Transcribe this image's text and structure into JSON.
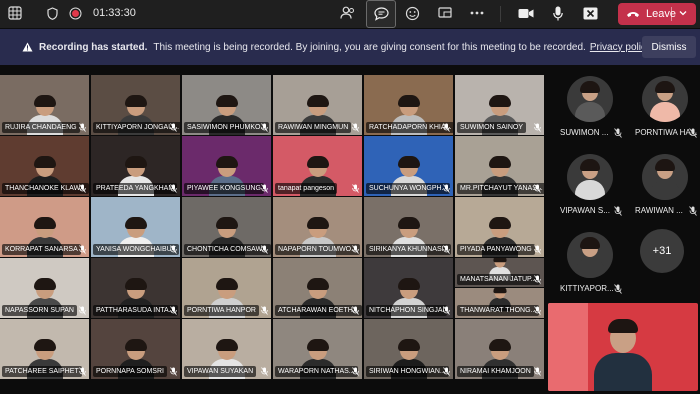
{
  "toolbar": {
    "timer": "01:33:30",
    "leave_label": "Leave"
  },
  "banner": {
    "title": "Recording has started.",
    "message": "This meeting is being recorded. By joining, you are giving consent for this meeting to be recorded.",
    "policy_link": "Privacy policy",
    "dismiss_label": "Dismiss"
  },
  "gallery": {
    "tiles": [
      {
        "name": "RUJIRA CHANDAENG",
        "bg": "#7a6c62",
        "shirt": "#dcdcdc"
      },
      {
        "name": "KITTIYAPORN JONGAU...",
        "bg": "#5b4d44",
        "shirt": "#3b3b3b"
      },
      {
        "name": "SASIWIMON PHUMKO...",
        "bg": "#8d8a86",
        "shirt": "#2a2a2a"
      },
      {
        "name": "RAWIWAN MINGMUN",
        "bg": "#a79f96",
        "shirt": "#3c3c3c"
      },
      {
        "name": "RATCHADAPORN KHIA...",
        "bg": "#8a6b50",
        "shirt": "#bcbcbc"
      },
      {
        "name": "SUWIMON SAINOY",
        "bg": "#b9b3ad",
        "shirt": "#5a5a5a"
      },
      {
        "name": "THANCHANOKE KLAW...",
        "bg": "#5f3c30",
        "shirt": "#1e1e1e"
      },
      {
        "name": "PRATEEDA YANGKHAM",
        "bg": "#2d2625",
        "shirt": "#e6e6e6"
      },
      {
        "name": "PIYAWEE KONGSUNG",
        "bg": "#6b2a6b",
        "shirt": "#5b6e8a"
      },
      {
        "name": "tanapat pangeson",
        "bg": "#d45a66",
        "shirt": "#2d2d2d"
      },
      {
        "name": "SUCHUNYA WONGPH...",
        "bg": "#2f63b7",
        "shirt": "#d8d8d8"
      },
      {
        "name": "MR.PITCHAYUT YANAS...",
        "bg": "#a9a195",
        "shirt": "#353535"
      },
      {
        "name": "KORRAPAT SANARSA",
        "bg": "#cf9b87",
        "shirt": "#3a3a3a"
      },
      {
        "name": "YANISA WONGCHAIBUT",
        "bg": "#9fb5c8",
        "shirt": "#efefef"
      },
      {
        "name": "CHONTICHA COMSAW...",
        "bg": "#6e6a66",
        "shirt": "#2a2a2a"
      },
      {
        "name": "NAPAPORN TOUMWO...",
        "bg": "#a48e7d",
        "shirt": "#c8c8c8"
      },
      {
        "name": "SIRIKANYA KHUNNASIT",
        "bg": "#7a7068",
        "shirt": "#dedede"
      },
      {
        "name": "PIYADA PANYAWONG",
        "bg": "#b7a996",
        "shirt": "#2f2f2f"
      },
      {
        "name": "NAPASSORN SUPAN",
        "bg": "#cfc9c2",
        "shirt": "#4a4a4a"
      },
      {
        "name": "PATTHARASUDA INTA...",
        "bg": "#3c3432",
        "shirt": "#222222"
      },
      {
        "name": "PORNTIWA HANPOR",
        "bg": "#b0a391",
        "shirt": "#cfcfcf"
      },
      {
        "name": "ATCHARAWAN EOETH...",
        "bg": "#8c8176",
        "shirt": "#2a2a2a"
      },
      {
        "name": "NITCHAPHON SINGJAI",
        "bg": "#3e3a3c",
        "shirt": "#d2d2d2"
      },
      {
        "name": "MANATSANAN JATUP...",
        "bg": "#5d5551",
        "shirt": "#e0e0e0"
      },
      {
        "name": "THANWARAT THONG...",
        "bg": "#9b8b7e",
        "shirt": "#2c2c2c"
      },
      {
        "name": "PATCHAREE SAIPHET",
        "bg": "#c2b9ae",
        "shirt": "#3a3a3a"
      },
      {
        "name": "PORNNAPA SOMSRI",
        "bg": "#54443e",
        "shirt": "#1f1f1f"
      },
      {
        "name": "VIPAWAN SUYAKAN",
        "bg": "#b9aea1",
        "shirt": "#e4e4e4"
      },
      {
        "name": "WARAPORN NATHAS...",
        "bg": "#8f877f",
        "shirt": "#2b2b2b"
      },
      {
        "name": "SIRIWAN HONGWIAN...",
        "bg": "#6d655e",
        "shirt": "#1c1c1c"
      },
      {
        "name": "NIRAMAI KHAMJOON",
        "bg": "#8a8079",
        "shirt": "#303030"
      }
    ]
  },
  "sidebar": {
    "attendees": [
      {
        "name": "SUWIMON ...",
        "shirt": "#5a5a5a"
      },
      {
        "name": "PORNTIWA HA...",
        "shirt": "#efb9a8"
      },
      {
        "name": "VIPAWAN S...",
        "shirt": "#d8d8d8"
      },
      {
        "name": "RAWIWAN ...",
        "shirt": "#3a3a3a"
      },
      {
        "name": "KITTIYAPOR...",
        "shirt": "#3a3a3a"
      }
    ],
    "overflow_count": "+31"
  },
  "colors": {
    "leave": "#c4314b",
    "banner": "#292c4e",
    "toolbar": "#1f1f1f"
  }
}
